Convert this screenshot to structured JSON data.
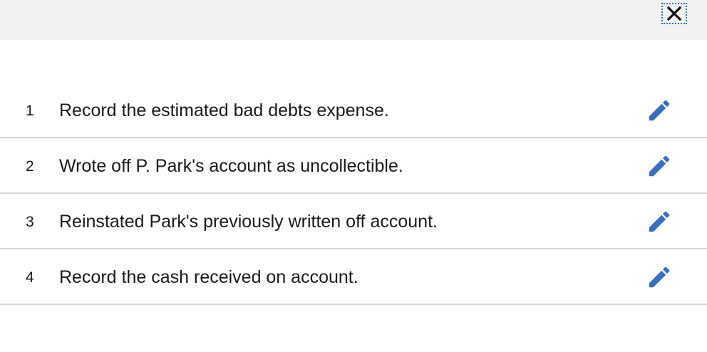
{
  "header": {
    "close_icon": "close-icon"
  },
  "rows": [
    {
      "number": "1",
      "text": "Record the estimated bad debts expense.",
      "icon": "pencil-icon"
    },
    {
      "number": "2",
      "text": "Wrote off P. Park's account as uncollectible.",
      "icon": "pencil-icon"
    },
    {
      "number": "3",
      "text": "Reinstated Park's previously written off account.",
      "icon": "pencil-icon"
    },
    {
      "number": "4",
      "text": "Record the cash received on account.",
      "icon": "pencil-icon"
    }
  ],
  "colors": {
    "topbar": "#f2f2f2",
    "accent": "#3a6fbf",
    "divider": "#d6d6d6",
    "text": "#1a1a1a"
  }
}
